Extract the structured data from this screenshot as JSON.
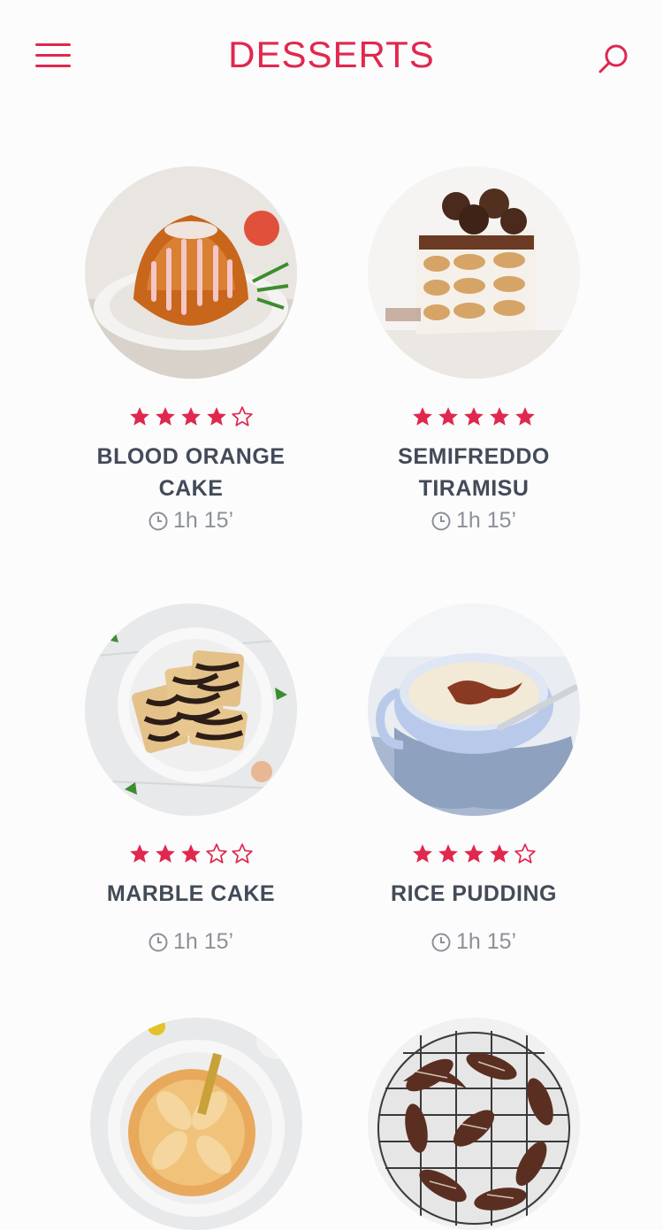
{
  "header": {
    "title": "DESSERTS"
  },
  "colors": {
    "accent": "#e0284f",
    "text": "#434a58",
    "muted": "#8d9099",
    "background": "#fcfcfc"
  },
  "recipes": [
    {
      "name_line1": "BLOOD ORANGE",
      "name_line2": "CAKE",
      "rating": 4,
      "max_rating": 5,
      "time": "1h 15’"
    },
    {
      "name_line1": "SEMIFREDDO",
      "name_line2": "TIRAMISU",
      "rating": 5,
      "max_rating": 5,
      "time": "1h 15’"
    },
    {
      "name_line1": "MARBLE CAKE",
      "name_line2": "",
      "rating": 3,
      "max_rating": 5,
      "time": "1h 15’"
    },
    {
      "name_line1": "RICE PUDDING",
      "name_line2": "",
      "rating": 4,
      "max_rating": 5,
      "time": "1h 15’"
    },
    {
      "name_line1": "",
      "name_line2": "",
      "rating": 0,
      "max_rating": 0,
      "time": ""
    },
    {
      "name_line1": "",
      "name_line2": "",
      "rating": 0,
      "max_rating": 0,
      "time": ""
    }
  ]
}
